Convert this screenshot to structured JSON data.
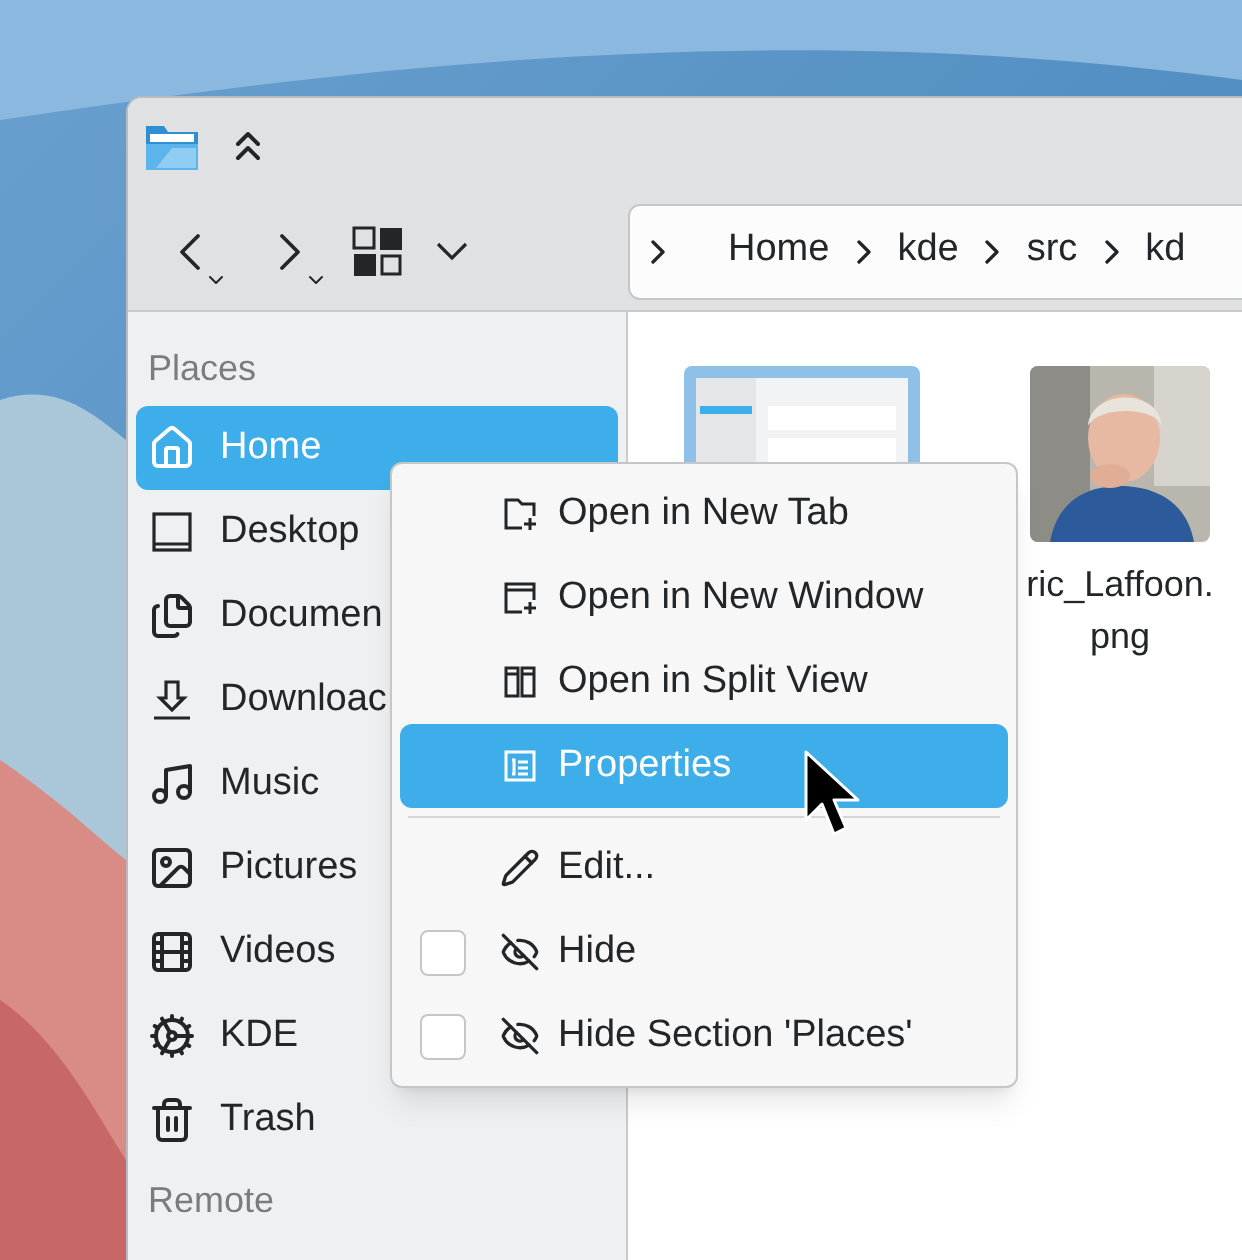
{
  "toolbar": {
    "breadcrumb": [
      "Home",
      "kde",
      "src",
      "kd"
    ]
  },
  "sidebar": {
    "sections": [
      {
        "title": "Places",
        "items": [
          {
            "label": "Home",
            "selected": true
          },
          {
            "label": "Desktop",
            "selected": false
          },
          {
            "label": "Documen",
            "selected": false
          },
          {
            "label": "Downloac",
            "selected": false
          },
          {
            "label": "Music",
            "selected": false
          },
          {
            "label": "Pictures",
            "selected": false
          },
          {
            "label": "Videos",
            "selected": false
          },
          {
            "label": "KDE",
            "selected": false
          },
          {
            "label": "Trash",
            "selected": false
          }
        ]
      },
      {
        "title": "Remote"
      }
    ]
  },
  "files": [
    {
      "kind": "picture"
    },
    {
      "kind": "picture",
      "name": "ric_Laffoon.png"
    }
  ],
  "context_menu": [
    {
      "kind": "action",
      "label": "Open in New Tab",
      "selected": false
    },
    {
      "kind": "action",
      "label": "Open in New Window",
      "selected": false
    },
    {
      "kind": "action",
      "label": "Open in Split View",
      "selected": false
    },
    {
      "kind": "action",
      "label": "Properties",
      "selected": true
    },
    {
      "kind": "separator"
    },
    {
      "kind": "action",
      "label": "Edit...",
      "selected": false
    },
    {
      "kind": "checkbox",
      "label": "Hide",
      "checked": false,
      "selected": false
    },
    {
      "kind": "checkbox",
      "label": "Hide Section 'Places'",
      "checked": false,
      "selected": false
    }
  ]
}
